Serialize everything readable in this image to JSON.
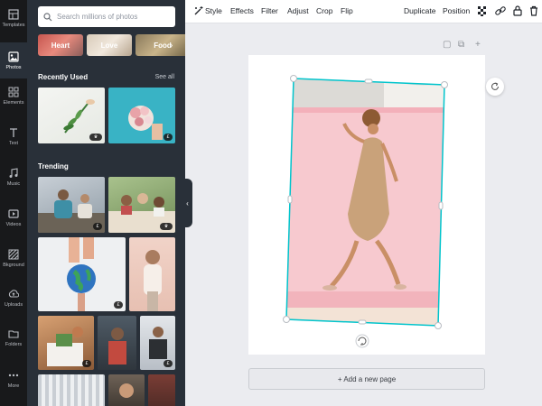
{
  "rail": [
    {
      "label": "Templates",
      "icon": "templates-icon"
    },
    {
      "label": "Photos",
      "icon": "photos-icon",
      "active": true
    },
    {
      "label": "Elements",
      "icon": "elements-icon"
    },
    {
      "label": "Text",
      "icon": "text-icon"
    },
    {
      "label": "Music",
      "icon": "music-icon"
    },
    {
      "label": "Videos",
      "icon": "videos-icon"
    },
    {
      "label": "Bkground",
      "icon": "background-icon"
    },
    {
      "label": "Uploads",
      "icon": "uploads-icon"
    },
    {
      "label": "Folders",
      "icon": "folders-icon"
    },
    {
      "label": "More",
      "icon": "more-icon"
    }
  ],
  "panel": {
    "search_placeholder": "Search millions of photos",
    "chips": [
      "Heart",
      "Love",
      "Food"
    ],
    "recent_title": "Recently Used",
    "see_all": "See all",
    "trending_title": "Trending"
  },
  "toolbar": {
    "style": "Style",
    "effects": "Effects",
    "filter": "Filter",
    "adjust": "Adjust",
    "crop": "Crop",
    "flip": "Flip",
    "duplicate": "Duplicate",
    "position": "Position"
  },
  "canvas": {
    "add_page": "+ Add a new page"
  },
  "colors": {
    "accent": "#00c4cc",
    "panel_bg": "#293039",
    "rail_bg": "#18191b",
    "canvas_bg": "#ebecf0"
  }
}
